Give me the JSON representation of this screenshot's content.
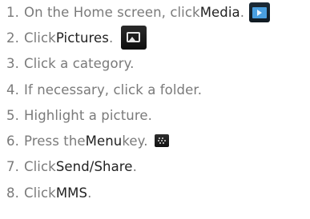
{
  "steps": [
    {
      "num": "1.",
      "pre": "On the Home screen, click ",
      "em": "Media",
      "post": ".",
      "icon": "media-icon"
    },
    {
      "num": "2.",
      "pre": "Click ",
      "em": "Pictures",
      "post": ".",
      "icon": "pictures-icon"
    },
    {
      "num": "3.",
      "pre": "Click a category.",
      "em": "",
      "post": "",
      "icon": ""
    },
    {
      "num": "4.",
      "pre": "If necessary, click a folder.",
      "em": "",
      "post": "",
      "icon": ""
    },
    {
      "num": "5.",
      "pre": "Highlight a picture.",
      "em": "",
      "post": "",
      "icon": ""
    },
    {
      "num": "6.",
      "pre": "Press the ",
      "em": "Menu",
      "post": " key.",
      "icon": "menu-key-icon"
    },
    {
      "num": "7.",
      "pre": "Click ",
      "em": "Send/Share",
      "post": ".",
      "icon": ""
    },
    {
      "num": "8.",
      "pre": "Click ",
      "em": "MMS",
      "post": ".",
      "icon": ""
    }
  ],
  "colors": {
    "text": "#7a7a7a",
    "emphasis": "#222222"
  }
}
